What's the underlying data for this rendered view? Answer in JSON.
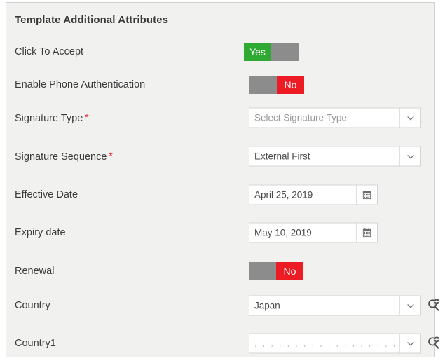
{
  "panel": {
    "title": "Template Additional Attributes"
  },
  "colors": {
    "panel_bg": "#f1f1f0",
    "panel_border": "#cfcfcf",
    "toggle_on": "#2eaa33",
    "toggle_off": "#ed1c24",
    "toggle_blank": "#8c8c8c",
    "required_asterisk": "#ed1c24",
    "label_text": "#3c3c3c",
    "field_text": "#4a4a4a",
    "placeholder_text": "#9a9a9a"
  },
  "rows": [
    {
      "label": "Click To Accept",
      "required": false,
      "control": "toggle",
      "value": "Yes",
      "state": "on"
    },
    {
      "label": "Enable Phone Authentication",
      "required": false,
      "control": "toggle",
      "value": "No",
      "state": "off"
    },
    {
      "label": "Signature Type",
      "required": true,
      "control": "select",
      "value": "Select Signature Type",
      "is_placeholder": true,
      "icon": "chevron-down-icon"
    },
    {
      "label": "Signature Sequence",
      "required": true,
      "control": "select",
      "value": "External First",
      "is_placeholder": false,
      "icon": "chevron-down-icon"
    },
    {
      "label": "Effective Date",
      "required": false,
      "control": "date",
      "value": "April 25, 2019",
      "icon": "calendar-icon"
    },
    {
      "label": "Expiry date",
      "required": false,
      "control": "date",
      "value": "May 10, 2019",
      "icon": "calendar-icon"
    },
    {
      "label": "Renewal",
      "required": false,
      "control": "toggle",
      "value": "No",
      "state": "off"
    },
    {
      "label": "Country",
      "required": false,
      "control": "select",
      "value": "Japan",
      "is_placeholder": false,
      "icon": "chevron-down-icon",
      "lookup_icon": "lookup-add-icon"
    },
    {
      "label": "Country1",
      "required": false,
      "control": "select",
      "value": ", , , , , , , , , , , , , , , , , , , , , , ,",
      "is_placeholder": true,
      "icon": "chevron-down-icon",
      "lookup_icon": "lookup-add-icon"
    }
  ],
  "required_marker": "*"
}
